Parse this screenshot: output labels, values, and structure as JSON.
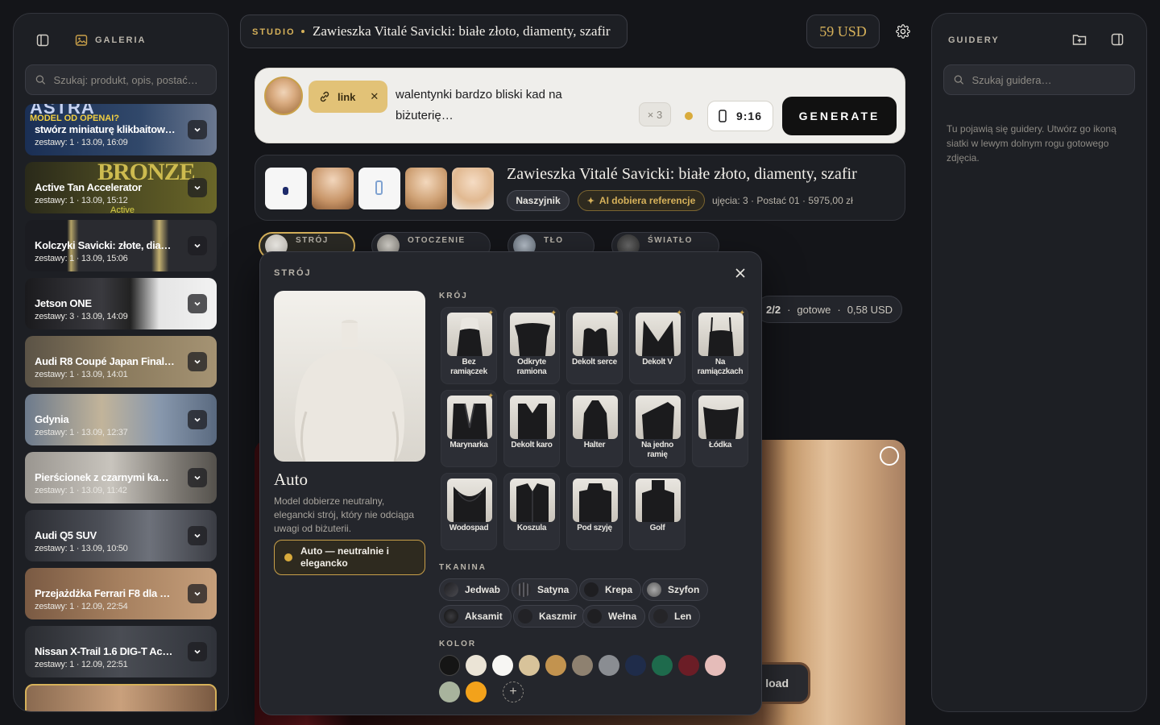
{
  "left": {
    "title": "GALERIA",
    "search_placeholder": "Szukaj: produkt, opis, postać…",
    "items": [
      {
        "title": "stwórz miniaturę klikbaitową…",
        "sub": "zestawy: 1 · 13.09, 16:09",
        "overlay": "ASTRA",
        "overlay2": "MODEL OD OPENAI?"
      },
      {
        "title": "Active Tan Accelerator",
        "sub": "zestawy: 1 · 13.09, 15:12",
        "overlay": "BRONZE",
        "badge": "Active"
      },
      {
        "title": "Kolczyki Savicki: złote, diam…",
        "sub": "zestawy: 1 · 13.09, 15:06"
      },
      {
        "title": "Jetson ONE",
        "sub": "zestawy: 3 · 13.09, 14:09"
      },
      {
        "title": "Audi R8 Coupé Japan Final E…",
        "sub": "zestawy: 1 · 13.09, 14:01"
      },
      {
        "title": "Gdynia",
        "sub": "zestawy: 1 · 13.09, 12:37"
      },
      {
        "title": "Pierścionek z czarnymi kami…",
        "sub": "zestawy: 1 · 13.09, 11:42"
      },
      {
        "title": "Audi Q5 SUV",
        "sub": "zestawy: 1 · 13.09, 10:50"
      },
      {
        "title": "Przejażdżka Ferrari F8 dla Dz…",
        "sub": "zestawy: 1 · 12.09, 22:54"
      },
      {
        "title": "Nissan X-Trail 1.6 DIG-T Ace…",
        "sub": "zestawy: 1 · 12.09, 22:51"
      }
    ]
  },
  "topbar": {
    "studio": "STUDIO",
    "title": "Zawieszka Vitalé Savicki: białe złoto, diamenty, szafir",
    "credits": "59 USD"
  },
  "prompt": {
    "link_label": "link",
    "text": "walentynki bardzo bliski kad na biżuterię…",
    "count": "× 3",
    "ratio": "9:16",
    "generate": "GENERATE"
  },
  "product": {
    "title": "Zawieszka Vitalé Savicki: białe złoto, diamenty, szafir",
    "category": "Naszyjnik",
    "ai_tag": "AI dobiera referencje",
    "meta": "ujęcia: 3 · Postać 01 · 5975,00 zł"
  },
  "tabs": [
    {
      "label": "STRÓJ"
    },
    {
      "label": "OTOCZENIE"
    },
    {
      "label": "TŁO"
    },
    {
      "label": "ŚWIATŁO"
    }
  ],
  "status": {
    "progress": "2/2",
    "state": "gotowe",
    "cost": "0,58 USD"
  },
  "download_label": "load",
  "popup": {
    "title": "STRÓJ",
    "preview_name": "Auto",
    "preview_desc": "Model dobierze neutralny, elegancki strój, który nie odciąga uwagi od biżuterii.",
    "preview_option": "Auto — neutralnie i elegancko",
    "cut_heading": "KRÓJ",
    "cuts": [
      {
        "label": "Bez ramiączek"
      },
      {
        "label": "Odkryte ramiona"
      },
      {
        "label": "Dekolt serce"
      },
      {
        "label": "Dekolt V"
      },
      {
        "label": "Na ramiączkach"
      },
      {
        "label": "Marynarka"
      },
      {
        "label": "Dekolt karo"
      },
      {
        "label": "Halter"
      },
      {
        "label": "Na jedno ramię"
      },
      {
        "label": "Łódka"
      },
      {
        "label": "Wodospad"
      },
      {
        "label": "Koszula"
      },
      {
        "label": "Pod szyję"
      },
      {
        "label": "Golf"
      }
    ],
    "fabric_heading": "TKANINA",
    "fabrics": [
      "Jedwab",
      "Satyna",
      "Krepa",
      "Szyfon",
      "Aksamit",
      "Kaszmir",
      "Wełna",
      "Len"
    ],
    "color_heading": "KOLOR",
    "colors": [
      "#151515",
      "#ebe4d6",
      "#f7f6f3",
      "#d8c39a",
      "#c2934f",
      "#8e8170",
      "#8a8d92",
      "#1f2c4a",
      "#1e6a4c",
      "#6b1d26",
      "#e5bcb9",
      "#a8b39d",
      "#f3a21b"
    ]
  },
  "right": {
    "title": "GUIDERY",
    "search_placeholder": "Szukaj guidera…",
    "empty": "Tu pojawią się guidery. Utwórz go ikoną siatki w lewym dolnym rogu gotowego zdjęcia."
  }
}
